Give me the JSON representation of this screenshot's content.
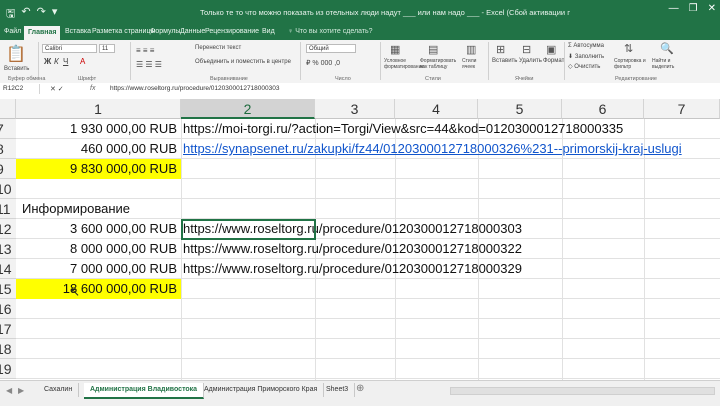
{
  "window": {
    "title": "Только те то что можно показать из отельных люди надут ___ или нам надо ___ - Excel (Сбой активации продукта)",
    "controls": [
      "—",
      "❐",
      "✕"
    ]
  },
  "ribbon_tabs": [
    "Файл",
    "Главная",
    "Вставка",
    "Разметка страницы",
    "Формулы",
    "Данные",
    "Рецензирование",
    "Вид"
  ],
  "tell_me": "♀ Что вы хотите сделать?",
  "ribbon": {
    "paste": "Вставить",
    "font_name": "Calibri",
    "font_size": "11",
    "wrap_text": "Перенести текст",
    "merge": "Объединить и поместить в центре",
    "number_format": "Общий",
    "conditional": "Условное форматирование",
    "format_table": "Форматировать как таблицу",
    "cell_styles": "Стили ячеек",
    "insert": "Вставить",
    "delete": "Удалить",
    "format": "Формат",
    "autosum": "Автосумма",
    "fill": "Заполнить",
    "clear": "Очистить",
    "sort": "Сортировка и фильтр",
    "find": "Найти и выделить",
    "groups": [
      "Буфер обмена",
      "Шрифт",
      "Выравнивание",
      "Число",
      "Стили",
      "Ячейки",
      "Редактирование"
    ]
  },
  "formula_bar": {
    "name_box": "R12C2",
    "fx": "fx",
    "value": "https://www.roseltorg.ru/procedure/0120300012718000303"
  },
  "columns": [
    "1",
    "2",
    "3",
    "4",
    "5",
    "6",
    "7"
  ],
  "rows": [
    {
      "num": "7",
      "c1": "1 930 000,00 RUB",
      "c2": "https://moi-torgi.ru/?action=Torgi/View&src=44&kod=0120300012718000335",
      "yellow": false,
      "link": false
    },
    {
      "num": "8",
      "c1": "460 000,00 RUB",
      "c2": "https://synapsenet.ru/zakupki/fz44/0120300012718000326%231--primorskij-kraj-uslugi",
      "yellow": false,
      "link": true
    },
    {
      "num": "9",
      "c1": "9 830 000,00 RUB",
      "c2": "",
      "yellow": true,
      "link": false
    },
    {
      "num": "10",
      "c1": "",
      "c2": "",
      "yellow": false,
      "link": false
    },
    {
      "num": "11",
      "c1": "Информирование",
      "c2": "",
      "yellow": false,
      "link": false,
      "label": true
    },
    {
      "num": "12",
      "c1": "3 600 000,00 RUB",
      "c2": "https://www.roseltorg.ru/procedure/0120300012718000303",
      "yellow": false,
      "link": false
    },
    {
      "num": "13",
      "c1": "8 000 000,00 RUB",
      "c2": "https://www.roseltorg.ru/procedure/0120300012718000322",
      "yellow": false,
      "link": false
    },
    {
      "num": "14",
      "c1": "7 000 000,00 RUB",
      "c2": "https://www.roseltorg.ru/procedure/0120300012718000329",
      "yellow": false,
      "link": false
    },
    {
      "num": "15",
      "c1": "18 600 000,00 RUB",
      "c2": "",
      "yellow": true,
      "link": false
    },
    {
      "num": "16",
      "c1": "",
      "c2": "",
      "yellow": false,
      "link": false
    },
    {
      "num": "17",
      "c1": "",
      "c2": "",
      "yellow": false,
      "link": false
    },
    {
      "num": "18",
      "c1": "",
      "c2": "",
      "yellow": false,
      "link": false
    },
    {
      "num": "19",
      "c1": "",
      "c2": "",
      "yellow": false,
      "link": false
    }
  ],
  "sheets": [
    {
      "name": "Сахалин",
      "active": false
    },
    {
      "name": "Администрация Владивостока",
      "active": true
    },
    {
      "name": "Администрация Приморского Края",
      "active": false
    },
    {
      "name": "Sheet3",
      "active": false
    }
  ],
  "icons": {
    "save": "save-icon",
    "undo": "undo-icon",
    "redo": "redo-icon",
    "add_sheet": "plus-circle-icon",
    "prev_sheet": "triangle-left-icon",
    "next_sheet": "triangle-right-icon"
  },
  "colors": {
    "accent": "#217346",
    "highlight": "#ffff00",
    "link": "#1155cc"
  }
}
